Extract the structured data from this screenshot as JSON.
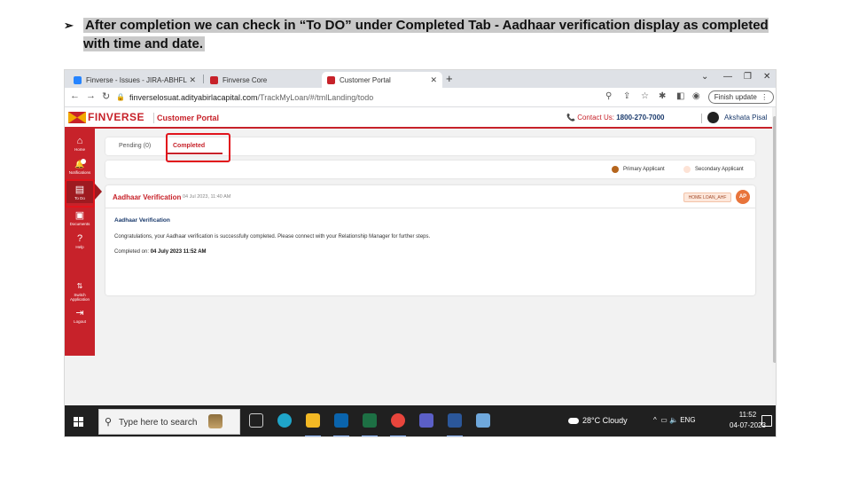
{
  "slide": {
    "bullet": "➢",
    "heading": "After completion we can check in “To DO” under Completed Tab - Aadhaar verification display as completed with time and date."
  },
  "browser": {
    "tabs": [
      {
        "title": "Finverse - Issues - JIRA-ABHFL"
      },
      {
        "title": "Finverse Core"
      },
      {
        "title": "Customer Portal"
      }
    ],
    "url_host": "finverselosuat.adityabirlacapital.com",
    "url_path": "/TrackMyLoan/#/tmlLanding/todo",
    "finish_update": "Finish update"
  },
  "app": {
    "brand": "FINVERSE",
    "portal_label": "Customer Portal",
    "contact_label": "Contact Us: ",
    "contact_number": "1800-270-7000",
    "user_name": "Akshata Pisal"
  },
  "sidebar": {
    "items": [
      {
        "icon": "⌂",
        "label": "Home"
      },
      {
        "icon": "🔔",
        "label": "Notifications"
      },
      {
        "icon": "▤",
        "label": "To Do"
      },
      {
        "icon": "▣",
        "label": "Documents"
      },
      {
        "icon": "?",
        "label": "Help"
      },
      {
        "icon": "⇅",
        "label": "Switch Application"
      },
      {
        "icon": "⇥",
        "label": "Logout"
      }
    ]
  },
  "tabs": {
    "pending": "Pending (0)",
    "completed": "Completed"
  },
  "legend": {
    "primary": "Primary Applicant",
    "secondary": "Secondary Applicant",
    "primary_color": "#b5651d",
    "secondary_color": "#fde3d6"
  },
  "card": {
    "title": "Aadhaar Verification",
    "timestamp": "04 Jul 2023, 11:40 AM",
    "loan_badge": "HOME LOAN_AHF",
    "avatar": "AP",
    "subtitle": "Aadhaar Verification",
    "message": "Congratulations, your Aadhaar verification is successfully completed. Please connect with your Relationship Manager for further steps.",
    "completed_label": "Completed on: ",
    "completed_value": "04 July 2023 11:52 AM"
  },
  "taskbar": {
    "search_placeholder": "Type here to search",
    "weather": "28°C Cloudy",
    "lang": "ENG",
    "time": "11:52",
    "date": "04-07-2023"
  },
  "colors": {
    "brand_red": "#c7222a",
    "highlight": "#e1141c"
  }
}
